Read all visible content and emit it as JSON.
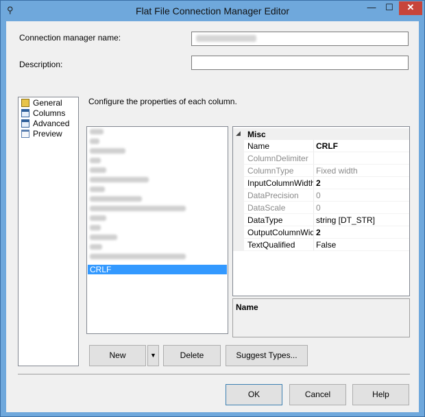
{
  "window": {
    "title": "Flat File Connection Manager Editor",
    "title_icon": "connection-manager-icon",
    "controls": {
      "minimize": "—",
      "maximize": "☐",
      "close": "✕"
    }
  },
  "form": {
    "connection_name_label": "Connection manager name:",
    "connection_name_value": "",
    "description_label": "Description:",
    "description_value": ""
  },
  "nav": {
    "items": [
      {
        "label": "General",
        "icon": "general-icon"
      },
      {
        "label": "Columns",
        "icon": "columns-icon"
      },
      {
        "label": "Advanced",
        "icon": "advanced-icon"
      },
      {
        "label": "Preview",
        "icon": "preview-icon"
      }
    ]
  },
  "advanced": {
    "instructions": "Configure the properties of each column.",
    "selected_column": "CRLF"
  },
  "properties": {
    "category": "Misc",
    "rows": [
      {
        "name": "Name",
        "value": "CRLF"
      },
      {
        "name": "ColumnDelimiter",
        "value": ""
      },
      {
        "name": "ColumnType",
        "value": "Fixed width"
      },
      {
        "name": "InputColumnWidth",
        "value": "2"
      },
      {
        "name": "DataPrecision",
        "value": "0"
      },
      {
        "name": "DataScale",
        "value": "0"
      },
      {
        "name": "DataType",
        "value": "string [DT_STR]"
      },
      {
        "name": "OutputColumnWidth",
        "value": "2"
      },
      {
        "name": "TextQualified",
        "value": "False"
      }
    ],
    "description_title": "Name"
  },
  "buttons": {
    "new": "New",
    "new_dropdown": "▼",
    "delete": "Delete",
    "suggest": "Suggest Types...",
    "ok": "OK",
    "cancel": "Cancel",
    "help": "Help"
  },
  "colors": {
    "title_bar": "#6fa8dc",
    "close_button": "#c7453b",
    "selection": "#3399ff"
  }
}
